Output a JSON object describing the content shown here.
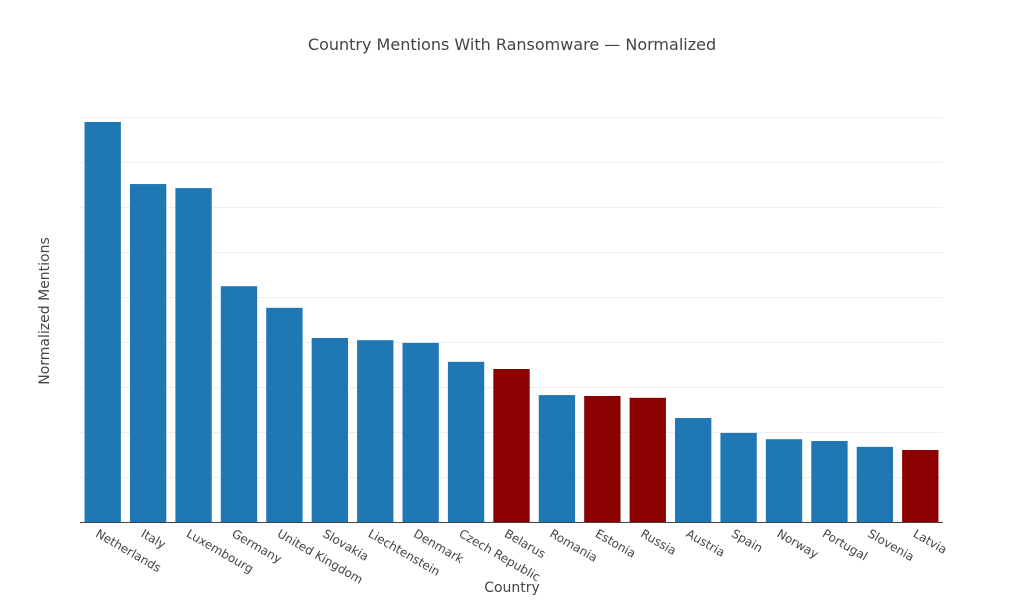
{
  "chart_data": {
    "type": "bar",
    "title": "Country Mentions With Ransomware — Normalized",
    "xlabel": "Country",
    "ylabel": "Normalized Mentions",
    "ylim": [
      0,
      9
    ],
    "y_ticks_labeled": false,
    "grid": true,
    "categories": [
      "Netherlands",
      "Italy",
      "Luxembourg",
      "Germany",
      "United Kingdom",
      "Slovakia",
      "Liechtenstein",
      "Denmark",
      "Czech Republic",
      "Belarus",
      "Romania",
      "Estonia",
      "Russia",
      "Austria",
      "Spain",
      "Norway",
      "Portugal",
      "Slovenia",
      "Latvia"
    ],
    "values": [
      8.89,
      7.51,
      7.42,
      5.24,
      4.76,
      4.09,
      4.04,
      3.98,
      3.56,
      3.4,
      2.82,
      2.8,
      2.76,
      2.31,
      1.98,
      1.84,
      1.8,
      1.67,
      1.6
    ],
    "highlight": [
      false,
      false,
      false,
      false,
      false,
      false,
      false,
      false,
      false,
      true,
      false,
      true,
      true,
      false,
      false,
      false,
      false,
      false,
      true
    ],
    "colors": {
      "default": "#1f77b4",
      "highlight": "#8b0000",
      "grid": "#eeeeee",
      "axis": "#444444"
    }
  }
}
